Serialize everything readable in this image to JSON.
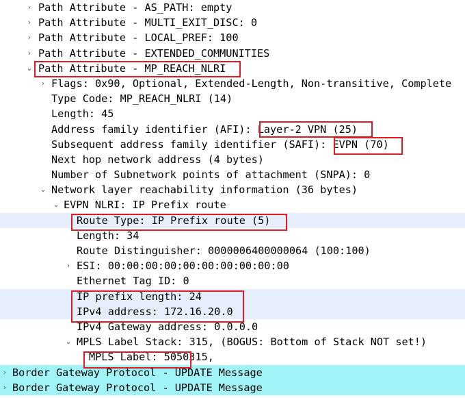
{
  "packet_details": {
    "rows": [
      {
        "text": "Path Attribute - AS_PATH: empty",
        "expander": "collapsed"
      },
      {
        "text": "Path Attribute - MULTI_EXIT_DISC: 0",
        "expander": "collapsed"
      },
      {
        "text": "Path Attribute - LOCAL_PREF: 100",
        "expander": "collapsed"
      },
      {
        "text": "Path Attribute - EXTENDED_COMMUNITIES",
        "expander": "collapsed"
      },
      {
        "text": "Path Attribute - MP_REACH_NLRI",
        "expander": "expanded"
      },
      {
        "text": "Flags: 0x90, Optional, Extended-Length, Non-transitive, Complete",
        "expander": "collapsed"
      },
      {
        "text": "Type Code: MP_REACH_NLRI (14)",
        "expander": "none"
      },
      {
        "text": "Length: 45",
        "expander": "none"
      },
      {
        "text": "Address family identifier (AFI): Layer-2 VPN (25)",
        "expander": "none"
      },
      {
        "text": "Subsequent address family identifier (SAFI): EVPN (70)",
        "expander": "none"
      },
      {
        "text": "Next hop network address (4 bytes)",
        "expander": "none"
      },
      {
        "text": "Number of Subnetwork points of attachment (SNPA): 0",
        "expander": "none"
      },
      {
        "text": "Network layer reachability information (36 bytes)",
        "expander": "expanded"
      },
      {
        "text": "EVPN NLRI: IP Prefix route",
        "expander": "expanded"
      },
      {
        "text": "Route Type: IP Prefix route (5)",
        "expander": "none"
      },
      {
        "text": "Length: 34",
        "expander": "none"
      },
      {
        "text": "Route Distinguisher: 0000006400000064 (100:100)",
        "expander": "none"
      },
      {
        "text": "ESI: 00:00:00:00:00:00:00:00:00:00",
        "expander": "collapsed"
      },
      {
        "text": "Ethernet Tag ID: 0",
        "expander": "none"
      },
      {
        "text": "IP prefix length: 24",
        "expander": "none"
      },
      {
        "text": "IPv4 address: 172.16.20.0",
        "expander": "none"
      },
      {
        "text": "IPv4 Gateway address: 0.0.0.0",
        "expander": "none"
      },
      {
        "text": "MPLS Label Stack: 315, (BOGUS: Bottom of Stack NOT set!)",
        "expander": "expanded"
      },
      {
        "text": "MPLS Label: 5050315,",
        "expander": "none"
      },
      {
        "text": "Border Gateway Protocol - UPDATE Message",
        "expander": "collapsed"
      },
      {
        "text": "Border Gateway Protocol - UPDATE Message",
        "expander": "collapsed"
      }
    ]
  },
  "colors": {
    "highlight_box": "#e01b24",
    "selected_row": "#e7eefb",
    "bgp_row": "#a0f4f8"
  },
  "icons": {
    "collapsed": "chevron-right-icon",
    "expanded": "chevron-down-icon"
  }
}
